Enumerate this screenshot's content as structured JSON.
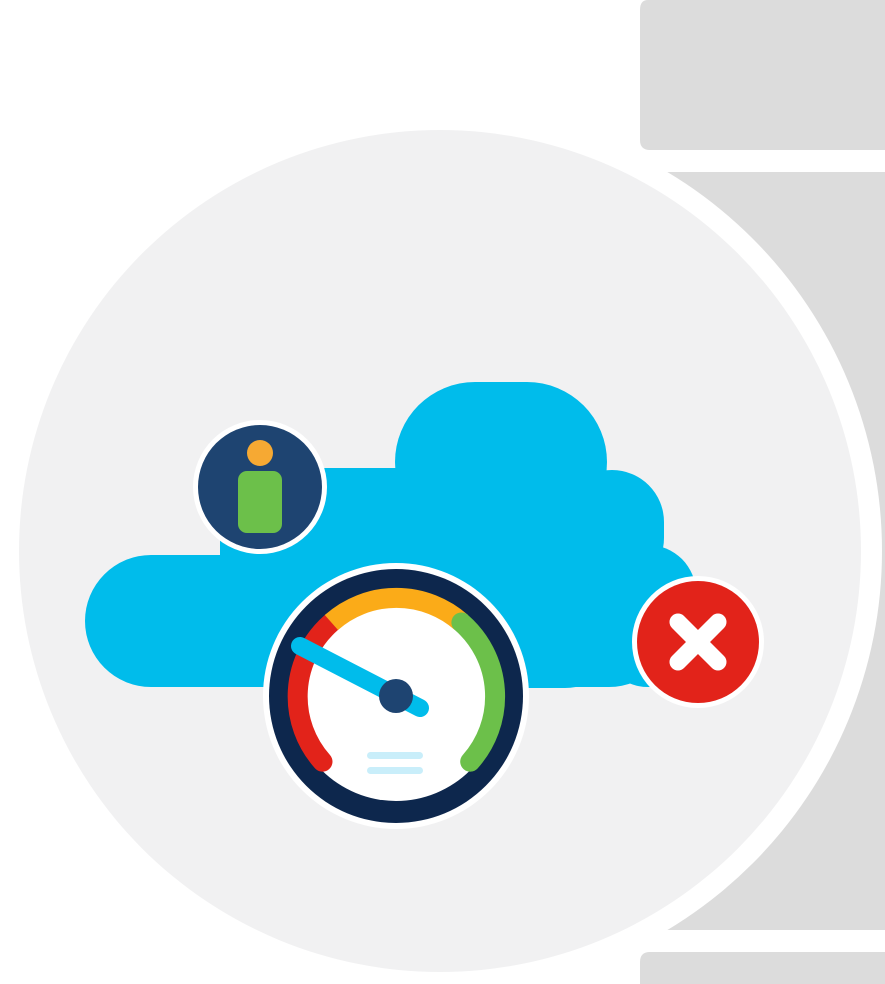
{
  "illustration": {
    "icons": {
      "cloud": "cloud-icon",
      "user_info": "user-info-icon",
      "gauge": "speedometer-icon",
      "error": "close-icon"
    },
    "gauge_level": 0.15,
    "colors": {
      "page_background": "#ffffff",
      "panel": "#dcdcdc",
      "circle_background": "#f1f1f2",
      "cloud": "#00bceb",
      "badge_navy": "#1e4471",
      "person_head": "#f6a933",
      "person_body": "#6cc04a",
      "gauge_ring": "#0d274d",
      "gauge_red": "#e2231a",
      "gauge_amber": "#fbab18",
      "gauge_green": "#6cc04a",
      "needle": "#00bceb",
      "error_red": "#e2231a",
      "error_mark": "#ffffff"
    }
  }
}
